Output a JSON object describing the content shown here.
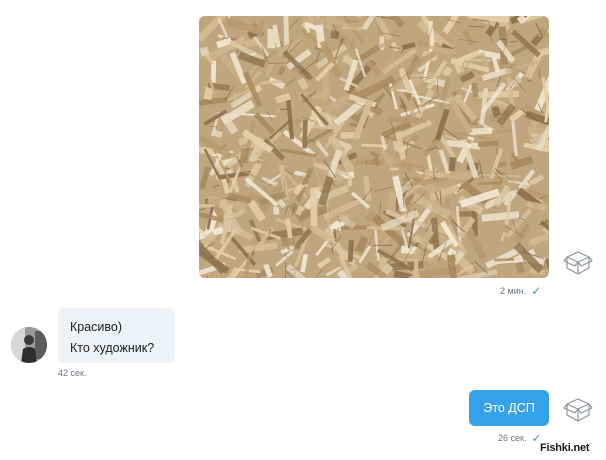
{
  "messages": {
    "outgoing_photo": {
      "image_alt": "OSB wood particle board texture",
      "time": "2 мин.",
      "status_icon": "checkmark-icon"
    },
    "incoming": {
      "line1": "Красиво)",
      "line2": "Кто художник?",
      "time": "42 сек."
    },
    "outgoing_text": {
      "text": "Это ДСП",
      "time": "26 сек.",
      "status_icon": "checkmark-icon"
    }
  },
  "icons": {
    "sticker": "open-box-icon",
    "read": "checkmark-icon"
  },
  "watermark": "Fishki.net",
  "colors": {
    "outgoing_bubble": "#35a1e8",
    "incoming_bubble": "#eef1f5",
    "check": "#3a8ee6",
    "meta_text": "#6b7480"
  }
}
